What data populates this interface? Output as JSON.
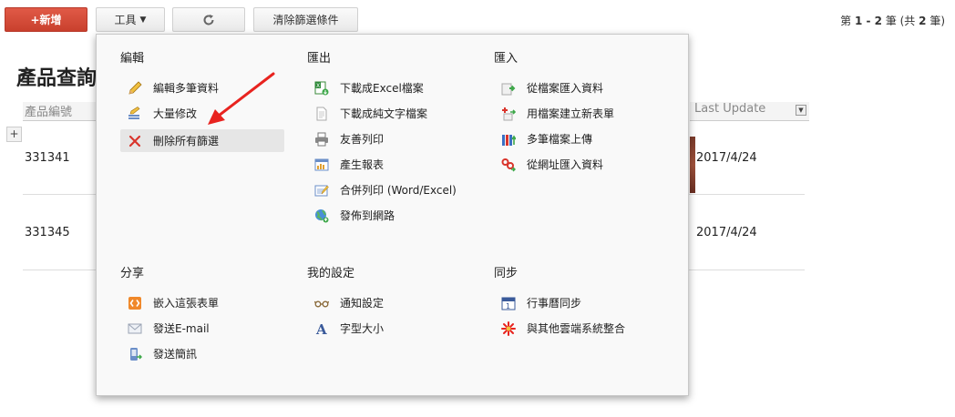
{
  "toolbar": {
    "new_label": "+新增",
    "tools_label": "工具",
    "refresh_icon": "refresh-icon",
    "clear_filter_label": "清除篩選條件",
    "paging": {
      "prefix": "第 ",
      "range": "1 - 2",
      "mid": " 筆 (共 ",
      "total": "2",
      "suffix": " 筆)"
    }
  },
  "page": {
    "title": "產品查詢",
    "columns": {
      "first": "產品編號",
      "last": "Last Update"
    },
    "rows": [
      {
        "id": "331341",
        "updated": "2017/4/24"
      },
      {
        "id": "331345",
        "updated": "2017/4/24"
      }
    ],
    "expand_label": "+"
  },
  "menu": {
    "edit": {
      "title": "編輯",
      "items": [
        {
          "label": "編輯多筆資料",
          "icon": "pencil-icon"
        },
        {
          "label": "大量修改",
          "icon": "bulk-edit-icon"
        },
        {
          "label": "刪除所有篩選",
          "icon": "delete-x-icon"
        }
      ]
    },
    "export": {
      "title": "匯出",
      "items": [
        {
          "label": "下載成Excel檔案",
          "icon": "excel-download-icon"
        },
        {
          "label": "下載成純文字檔案",
          "icon": "text-file-icon"
        },
        {
          "label": "友善列印",
          "icon": "printer-icon"
        },
        {
          "label": "產生報表",
          "icon": "report-icon"
        },
        {
          "label": "合併列印 (Word/Excel)",
          "icon": "mail-merge-icon"
        },
        {
          "label": "發佈到網路",
          "icon": "globe-icon"
        }
      ]
    },
    "import": {
      "title": "匯入",
      "items": [
        {
          "label": "從檔案匯入資料",
          "icon": "import-file-icon"
        },
        {
          "label": "用檔案建立新表單",
          "icon": "new-form-icon"
        },
        {
          "label": "多筆檔案上傳",
          "icon": "multi-upload-icon"
        },
        {
          "label": "從網址匯入資料",
          "icon": "link-import-icon"
        }
      ]
    },
    "share": {
      "title": "分享",
      "items": [
        {
          "label": "嵌入這張表單",
          "icon": "embed-code-icon"
        },
        {
          "label": "發送E-mail",
          "icon": "email-icon"
        },
        {
          "label": "發送簡訊",
          "icon": "sms-icon"
        }
      ]
    },
    "settings": {
      "title": "我的設定",
      "items": [
        {
          "label": "通知設定",
          "icon": "glasses-icon"
        },
        {
          "label": "字型大小",
          "icon": "font-size-icon"
        }
      ]
    },
    "sync": {
      "title": "同步",
      "items": [
        {
          "label": "行事曆同步",
          "icon": "calendar-icon"
        },
        {
          "label": "與其他雲端系統整合",
          "icon": "integration-icon"
        }
      ]
    }
  },
  "colors": {
    "new_button": "#d44a37",
    "arrow": "#e8231f"
  }
}
